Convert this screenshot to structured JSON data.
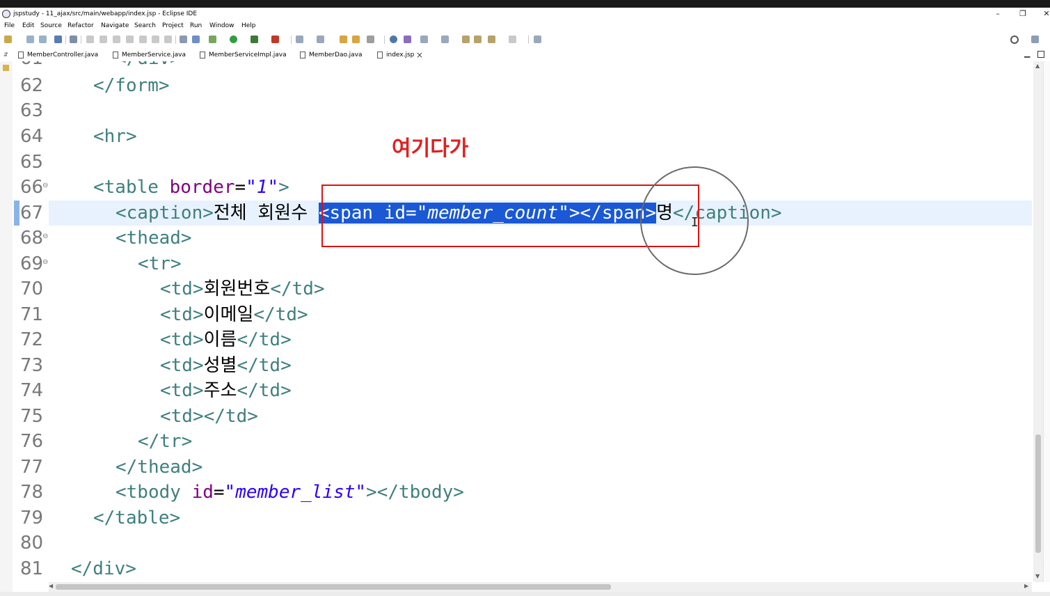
{
  "window": {
    "title": "jspstudy - 11_ajax/src/main/webapp/index.jsp - Eclipse IDE",
    "controls": {
      "minimize": "–",
      "restore": "❐",
      "close": "✕"
    }
  },
  "menu": [
    "File",
    "Edit",
    "Source",
    "Refactor",
    "Navigate",
    "Search",
    "Project",
    "Run",
    "Window",
    "Help"
  ],
  "tabs": [
    {
      "label": "MemberController.java",
      "active": false
    },
    {
      "label": "MemberService.java",
      "active": false
    },
    {
      "label": "MemberServiceImpl.java",
      "active": false
    },
    {
      "label": "MemberDao.java",
      "active": false
    },
    {
      "label": "index.jsp",
      "active": true
    }
  ],
  "tab_close": "×",
  "editor": {
    "current_line": "67",
    "lines": [
      {
        "no": "62",
        "fold": ""
      },
      {
        "no": "63",
        "fold": ""
      },
      {
        "no": "64",
        "fold": ""
      },
      {
        "no": "65",
        "fold": ""
      },
      {
        "no": "66",
        "fold": "⊖"
      },
      {
        "no": "67",
        "fold": ""
      },
      {
        "no": "68",
        "fold": "⊖"
      },
      {
        "no": "69",
        "fold": "⊖"
      },
      {
        "no": "70",
        "fold": ""
      },
      {
        "no": "71",
        "fold": ""
      },
      {
        "no": "72",
        "fold": ""
      },
      {
        "no": "73",
        "fold": ""
      },
      {
        "no": "74",
        "fold": ""
      },
      {
        "no": "75",
        "fold": ""
      },
      {
        "no": "76",
        "fold": ""
      },
      {
        "no": "77",
        "fold": ""
      },
      {
        "no": "78",
        "fold": ""
      },
      {
        "no": "79",
        "fold": ""
      },
      {
        "no": "80",
        "fold": ""
      },
      {
        "no": "81",
        "fold": ""
      }
    ],
    "code": {
      "l62": "</form>",
      "l64": "<hr>",
      "l66_tag": "<table ",
      "l66_attr": "border",
      "l66_eq": "=",
      "l66_val": "\"1\"",
      "l66_end": ">",
      "l67_open": "<caption>",
      "l67_text": "전체 회원수 ",
      "l67_sel_tag": "<span ",
      "l67_sel_attr": "id",
      "l67_sel_eq": "=",
      "l67_sel_val": "\"member_count\"",
      "l67_sel_end": "></span>",
      "l67_after": "명",
      "l67_close": "</caption>",
      "l68": "<thead>",
      "l69": "<tr>",
      "l70_o": "<td>",
      "l70_t": "회원번호",
      "l70_c": "</td>",
      "l71_o": "<td>",
      "l71_t": "이메일",
      "l71_c": "</td>",
      "l72_o": "<td>",
      "l72_t": "이름",
      "l72_c": "</td>",
      "l73_o": "<td>",
      "l73_t": "성별",
      "l73_c": "</td>",
      "l74_o": "<td>",
      "l74_t": "주소",
      "l74_c": "</td>",
      "l75": "<td></td>",
      "l76": "</tr>",
      "l77": "</thead>",
      "l78_tag": "<tbody ",
      "l78_attr": "id",
      "l78_eq": "=",
      "l78_val": "\"member_list\"",
      "l78_end": "></tbody>",
      "l79": "</table>",
      "l81": "</div>"
    }
  },
  "annotation": {
    "text": "여기다가",
    "color": "#e02020"
  }
}
